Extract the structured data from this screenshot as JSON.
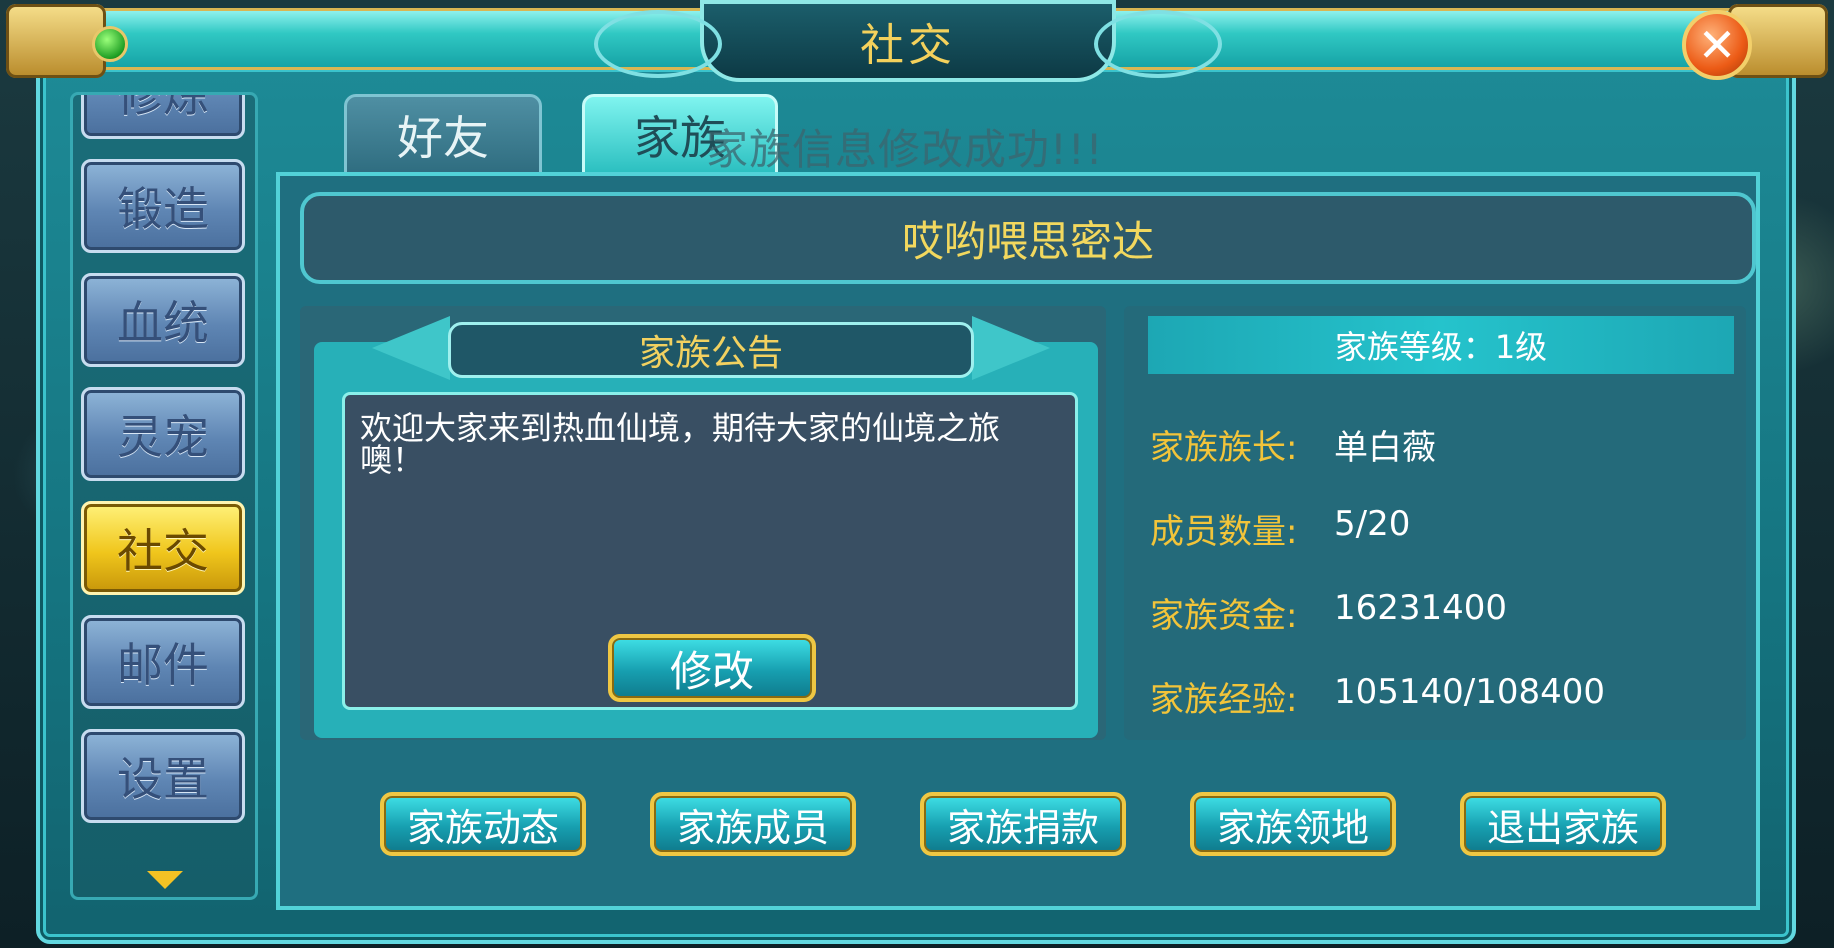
{
  "window": {
    "title": "社交",
    "close_glyph": "✕"
  },
  "sidebar": {
    "items": [
      {
        "label": "锻造",
        "active": false
      },
      {
        "label": "血统",
        "active": false
      },
      {
        "label": "灵宠",
        "active": false
      },
      {
        "label": "社交",
        "active": true
      },
      {
        "label": "邮件",
        "active": false
      },
      {
        "label": "设置",
        "active": false
      }
    ],
    "partial_item_label": "修炼"
  },
  "tabs": [
    {
      "label": "好友",
      "active": false
    },
    {
      "label": "家族",
      "active": true
    }
  ],
  "toast": "家族信息修改成功!!!",
  "family": {
    "name": "哎哟喂思密达",
    "notice_title": "家族公告",
    "notice_text": "欢迎大家来到热血仙境，期待大家的仙境之旅噢！",
    "edit_label": "修改",
    "level_text": "家族等级：1级",
    "info": [
      {
        "label": "家族族长:",
        "value": "单白薇"
      },
      {
        "label": "成员数量:",
        "value": "5/20"
      },
      {
        "label": "家族资金:",
        "value": "16231400"
      },
      {
        "label": "家族经验:",
        "value": "105140/108400"
      }
    ]
  },
  "actions": [
    {
      "label": "家族动态"
    },
    {
      "label": "家族成员"
    },
    {
      "label": "家族捐款"
    },
    {
      "label": "家族领地"
    },
    {
      "label": "退出家族"
    }
  ],
  "colors": {
    "gold_text": "#f2c43a",
    "panel_teal": "#1f6f80",
    "active_gold": "#f0c61c"
  }
}
